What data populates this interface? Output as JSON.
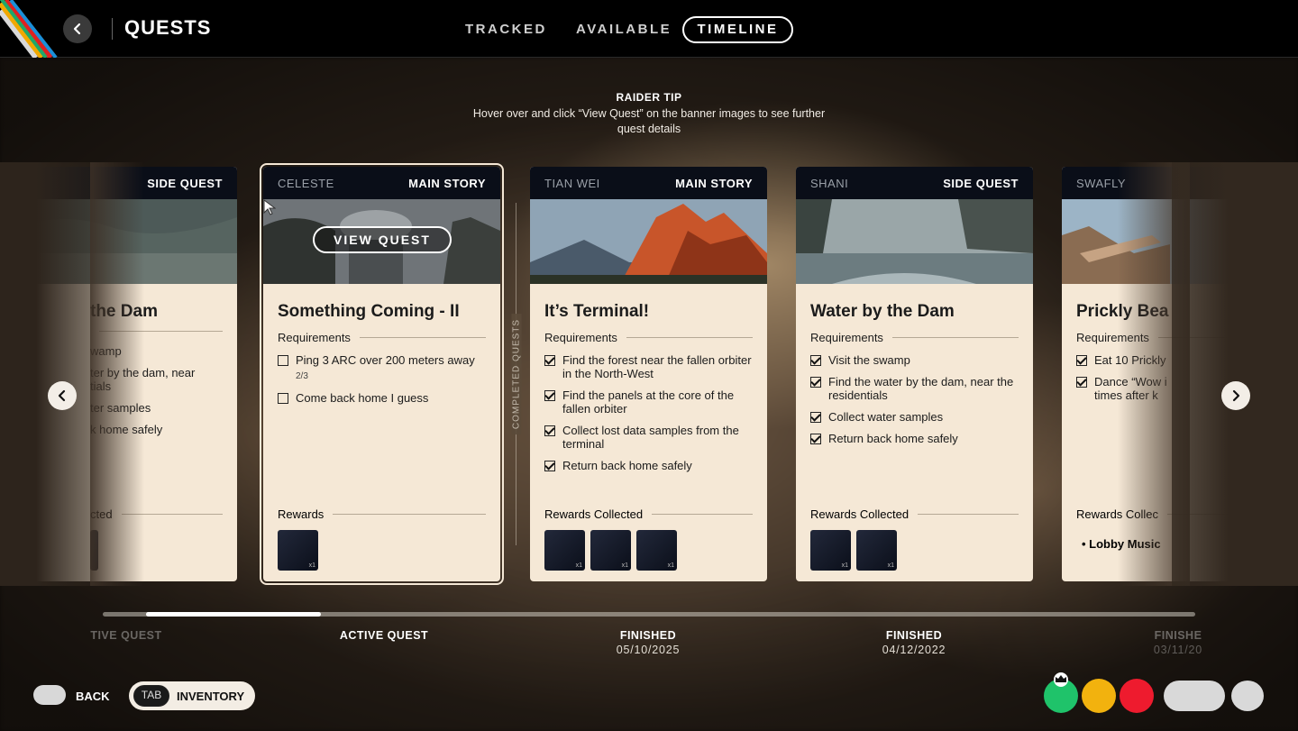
{
  "header": {
    "title": "QUESTS",
    "tabs": [
      {
        "label": "TRACKED"
      },
      {
        "label": "AVAILABLE"
      },
      {
        "label": "TIMELINE",
        "active": true
      }
    ]
  },
  "tip": {
    "title": "RAIDER TIP",
    "body": "Hover over and click “View Quest” on the banner images to see further quest details"
  },
  "divider_label": "COMPLETED QUESTS",
  "cards": [
    {
      "npc": "",
      "type": "SIDE QUEST",
      "title": "the Dam",
      "requirements_label": "",
      "requirements": [
        "wamp",
        "ter by the dam, near",
        "tials",
        "ter samples",
        "k home safely"
      ],
      "rewards_label": "cted"
    },
    {
      "npc": "CELESTE",
      "type": "MAIN STORY",
      "view_quest": "VIEW QUEST",
      "title": "Something Coming - II",
      "requirements_label": "Requirements",
      "requirements": [
        {
          "text": "Ping 3 ARC over 200 meters away",
          "done": false,
          "progress": "2/3"
        },
        {
          "text": "Come back home I guess",
          "done": false
        }
      ],
      "rewards_label": "Rewards",
      "rewards": [
        {
          "qty": "x1"
        }
      ]
    },
    {
      "npc": "TIAN WEI",
      "type": "MAIN STORY",
      "title": "It’s Terminal!",
      "requirements_label": "Requirements",
      "requirements": [
        {
          "text": "Find the forest near the fallen orbiter in the North-West",
          "done": true
        },
        {
          "text": "Find the panels at the core of the fallen orbiter",
          "done": true
        },
        {
          "text": "Collect lost data samples from the terminal",
          "done": true
        },
        {
          "text": "Return back home safely",
          "done": true
        }
      ],
      "rewards_label": "Rewards Collected",
      "rewards": [
        {
          "qty": "x1"
        },
        {
          "qty": "x1"
        },
        {
          "qty": "x1"
        }
      ]
    },
    {
      "npc": "SHANI",
      "type": "SIDE QUEST",
      "title": "Water by the Dam",
      "requirements_label": "Requirements",
      "requirements": [
        {
          "text": "Visit the swamp",
          "done": true
        },
        {
          "text": "Find the water by the dam, near the residentials",
          "done": true
        },
        {
          "text": "Collect water samples",
          "done": true
        },
        {
          "text": "Return back home safely",
          "done": true
        }
      ],
      "rewards_label": "Rewards Collected",
      "rewards": [
        {
          "qty": "x1"
        },
        {
          "qty": "x1"
        }
      ]
    },
    {
      "npc": "SWAFLY",
      "type": "",
      "title": "Prickly Bea",
      "requirements_label": "Requirements",
      "requirements": [
        {
          "text": "Eat 10 Prickly",
          "done": true
        },
        {
          "text": "Dance “Wow i",
          "text2": "times after k",
          "done": true
        }
      ],
      "rewards_label": "Rewards Collec",
      "reward_text": "• Lobby Music"
    }
  ],
  "timeline": {
    "progress": 0.16,
    "points": [
      {
        "status": "TIVE QUEST",
        "date": ""
      },
      {
        "status": "ACTIVE QUEST",
        "date": ""
      },
      {
        "status": "FINISHED",
        "date": "05/10/2025"
      },
      {
        "status": "FINISHED",
        "date": "04/12/2022"
      },
      {
        "status": "FINISHE",
        "date": "03/11/20"
      }
    ]
  },
  "footer": {
    "back_label": "BACK",
    "tab_key": "TAB",
    "inventory_label": "INVENTORY"
  },
  "colors": {
    "accent_green": "#1fc36a",
    "accent_yellow": "#f2b20e",
    "accent_red": "#ee1b2e",
    "card_bg": "#f5e8d6",
    "card_header": "#0a0e18"
  }
}
